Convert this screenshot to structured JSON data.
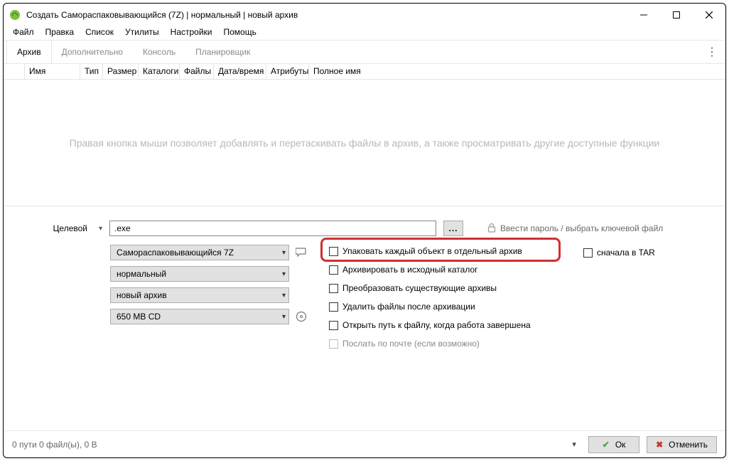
{
  "window": {
    "title": "Создать Самораспаковывающийся (7Z) | нормальный | новый архив"
  },
  "menubar": {
    "items": [
      "Файл",
      "Правка",
      "Список",
      "Утилиты",
      "Настройки",
      "Помощь"
    ]
  },
  "toolbar": {
    "items": [
      "Архив",
      "Дополнительно",
      "Консоль",
      "Планировщик"
    ],
    "active_index": 0
  },
  "columns": [
    "Имя",
    "Тип",
    "Размер",
    "Каталоги",
    "Файлы",
    "Дата/время",
    "Атрибуты",
    "Полное имя"
  ],
  "drop_hint": "Правая кнопка мыши позволяет добавлять и перетаскивать файлы в архив, а также просматривать другие доступные функции",
  "target": {
    "label": "Целевой",
    "value": ".exe",
    "browse": "...",
    "password_hint": "Ввести пароль / выбрать ключевой файл"
  },
  "dropdowns": {
    "format": "Самораспаковывающийся 7Z",
    "level": "нормальный",
    "mode": "новый архив",
    "volume": "650 MB CD"
  },
  "checks": {
    "pack_each": "Упаковать каждый объект в отдельный архив",
    "archive_source": "Архивировать в исходный каталог",
    "convert_existing": "Преобразовать существующие архивы",
    "delete_after": "Удалить файлы после архивации",
    "open_path": "Открыть путь к файлу, когда работа завершена",
    "send_mail": "Послать по почте (если возможно)"
  },
  "right_checks": {
    "tar_first": "сначала в TAR"
  },
  "footer": {
    "status": "0 пути 0 файл(ы), 0 B",
    "ok": "Ок",
    "cancel": "Отменить"
  }
}
